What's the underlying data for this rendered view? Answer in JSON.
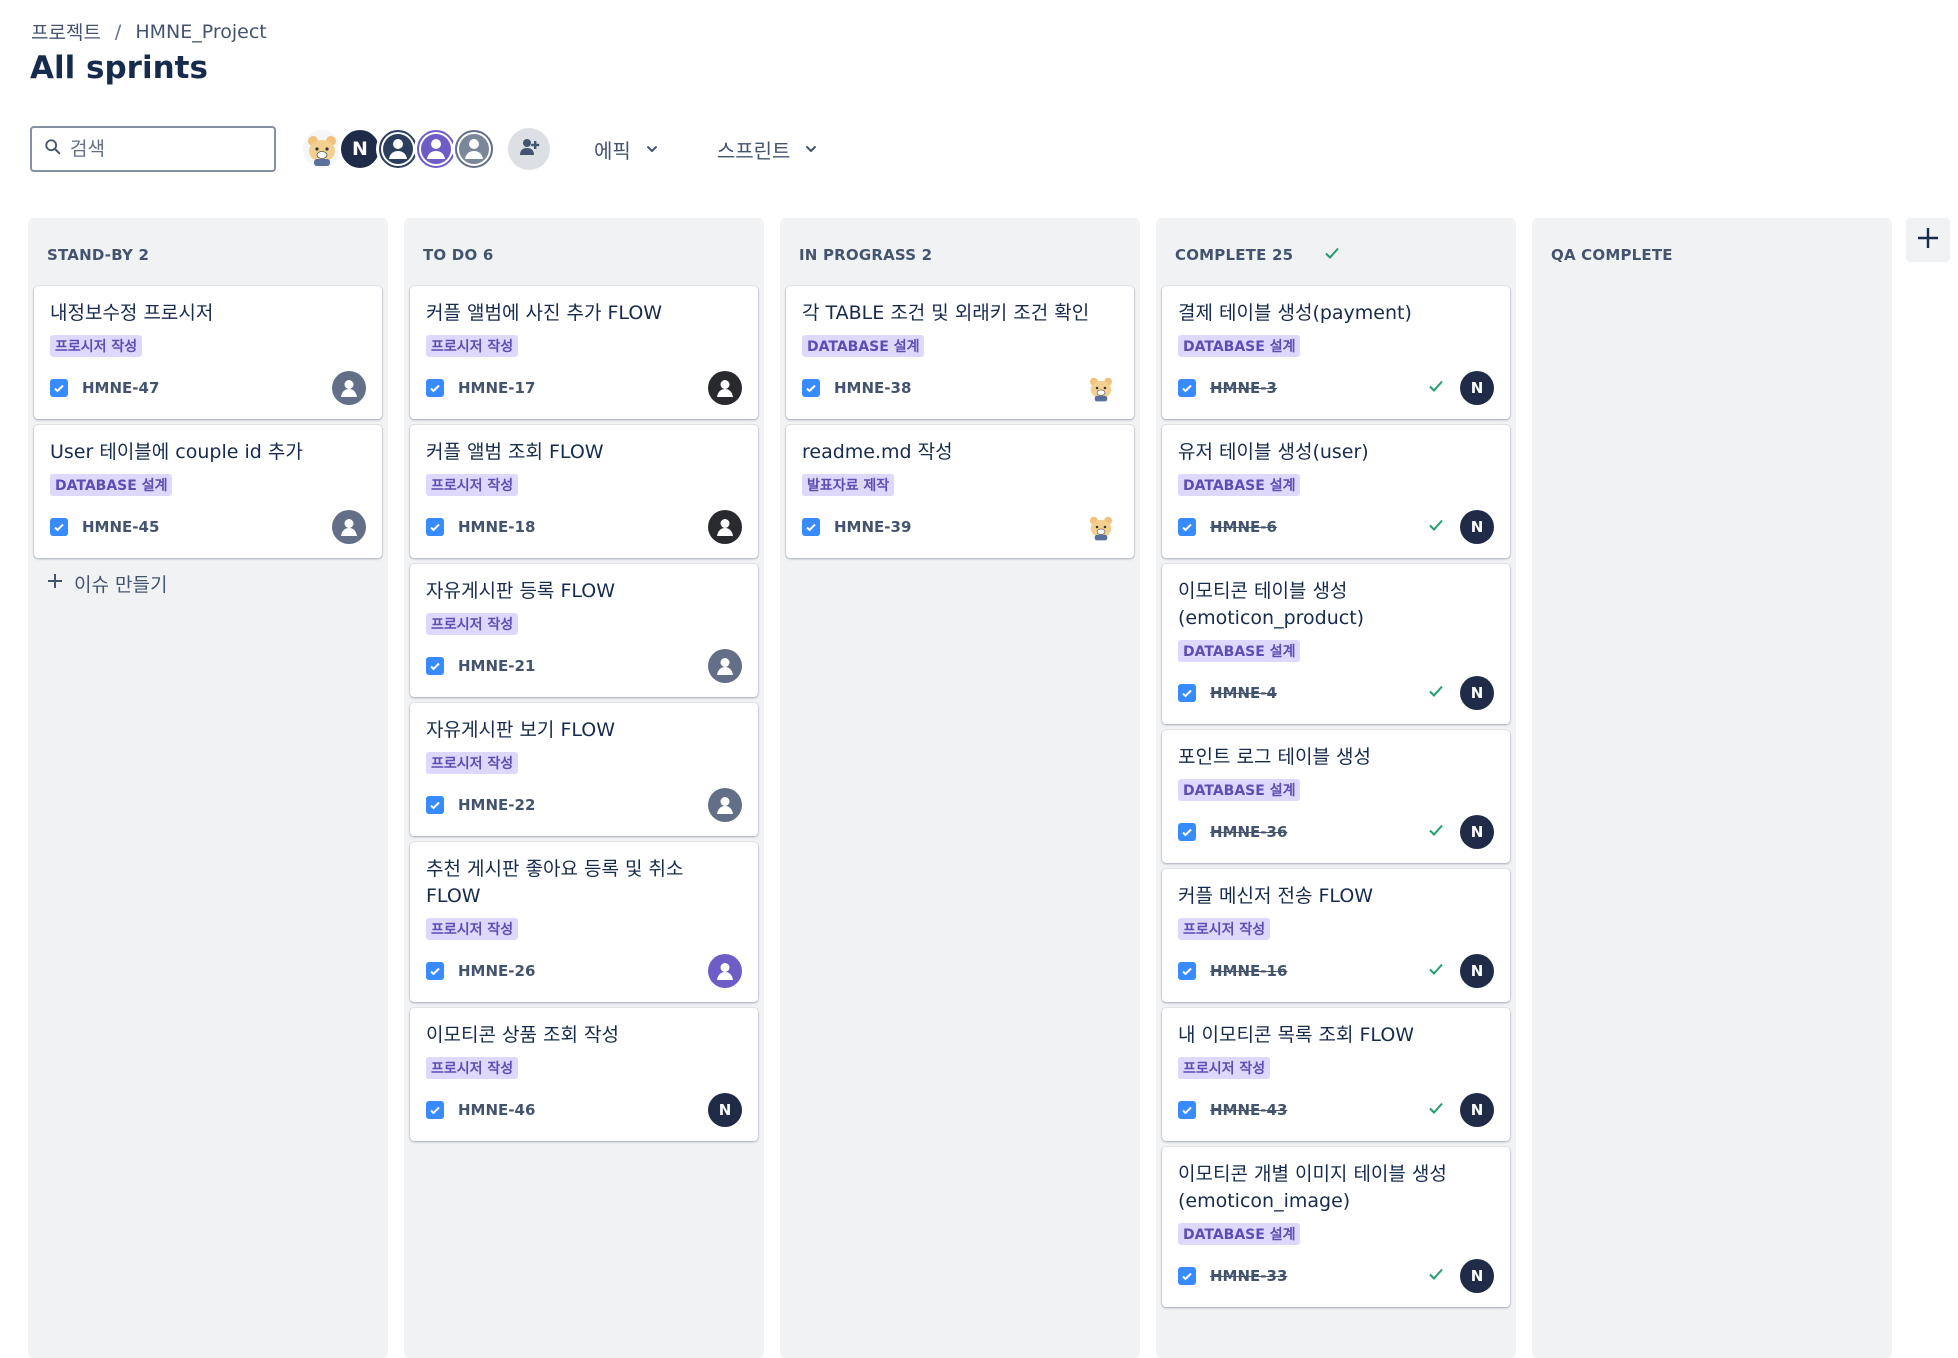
{
  "breadcrumb": {
    "root": "프로젝트",
    "separator": "/",
    "project": "HMNE_Project"
  },
  "page": {
    "title": "All sprints"
  },
  "search": {
    "placeholder": "검색"
  },
  "filters": {
    "epic": "에픽",
    "sprint": "스프린트"
  },
  "avatars": [
    "bear-avatar",
    "N",
    "person-avatar",
    "person-avatar-purple",
    "person-avatar-gray"
  ],
  "avatar_initial": "N",
  "columns": [
    {
      "title": "STAND-BY 2",
      "create_label": "이슈 만들기",
      "cards": [
        {
          "title": "내정보수정 프로시저",
          "label": "프로시저 작성",
          "key": "HMNE-47"
        },
        {
          "title": "User 테이블에 couple id 추가",
          "label": "DATABASE 설계",
          "key": "HMNE-45"
        }
      ]
    },
    {
      "title": "TO DO 6",
      "cards": [
        {
          "title": "커플 앨범에 사진 추가 FLOW",
          "label": "프로시저 작성",
          "key": "HMNE-17"
        },
        {
          "title": "커플 앨범 조회 FLOW",
          "label": "프로시저 작성",
          "key": "HMNE-18"
        },
        {
          "title": "자유게시판 등록 FLOW",
          "label": "프로시저 작성",
          "key": "HMNE-21"
        },
        {
          "title": "자유게시판 보기 FLOW",
          "label": "프로시저 작성",
          "key": "HMNE-22"
        },
        {
          "title": "추천 게시판 좋아요 등록 및 취소 FLOW",
          "label": "프로시저 작성",
          "key": "HMNE-26"
        },
        {
          "title": "이모티콘 상품 조회 작성",
          "label": "프로시저 작성",
          "key": "HMNE-46",
          "assignee": "N"
        }
      ]
    },
    {
      "title": "IN PROGRASS 2",
      "cards": [
        {
          "title": "각 TABLE 조건 및 외래키 조건 확인",
          "label": "DATABASE 설계",
          "key": "HMNE-38"
        },
        {
          "title": "readme.md 작성",
          "label": "발표자료 제작",
          "key": "HMNE-39"
        }
      ]
    },
    {
      "title": "COMPLETE 25",
      "cards": [
        {
          "title": "결제 테이블 생성(payment)",
          "label": "DATABASE 설계",
          "key": "HMNE-3",
          "assignee": "N"
        },
        {
          "title": "유저 테이블 생성(user)",
          "label": "DATABASE 설계",
          "key": "HMNE-6",
          "assignee": "N"
        },
        {
          "title": "이모티콘 테이블 생성(emoticon_product)",
          "label": "DATABASE 설계",
          "key": "HMNE-4",
          "assignee": "N"
        },
        {
          "title": "포인트 로그 테이블 생성",
          "label": "DATABASE 설계",
          "key": "HMNE-36",
          "assignee": "N"
        },
        {
          "title": "커플 메신저 전송 FLOW",
          "label": "프로시저 작성",
          "key": "HMNE-16",
          "assignee": "N"
        },
        {
          "title": "내 이모티콘 목록 조회 FLOW",
          "label": "프로시저 작성",
          "key": "HMNE-43",
          "assignee": "N"
        },
        {
          "title": "이모티콘 개별 이미지 테이블 생성(emoticon_image)",
          "label": "DATABASE 설계",
          "key": "HMNE-33",
          "assignee": "N"
        }
      ]
    },
    {
      "title": "QA COMPLETE",
      "cards": []
    }
  ],
  "colors": {
    "label_bg": "#dfd8fd",
    "label_text": "#5e4db2",
    "checkbox": "#388bff",
    "column_bg": "#f1f2f4",
    "done_check": "#22a06b"
  }
}
